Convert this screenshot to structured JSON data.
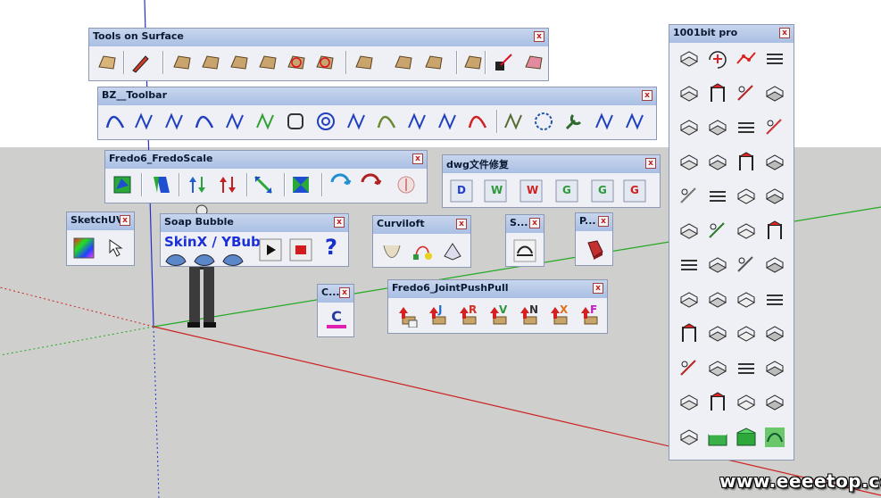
{
  "toolbars": {
    "tools_on_surface": {
      "title": "Tools on Surface"
    },
    "bz_toolbar": {
      "title": "BZ__Toolbar"
    },
    "fredo_scale": {
      "title": "Fredo6_FredoScale"
    },
    "dwg_repair": {
      "title": "dwg文件修复"
    },
    "sketchuv": {
      "title": "SketchUV"
    },
    "soap_bubble": {
      "title": "Soap Bubble",
      "label": "SkinX / YBub"
    },
    "curviloft": {
      "title": "Curviloft"
    },
    "s_small": {
      "title": "S..."
    },
    "p_small": {
      "title": "P..."
    },
    "c_small": {
      "title": "C..."
    },
    "joint_push_pull": {
      "title": "Fredo6_JointPushPull"
    },
    "bit1001": {
      "title": "1001bit pro"
    }
  },
  "dwg_buttons": [
    "D",
    "W",
    "W",
    "G",
    "G",
    "G"
  ],
  "jpp_letters": [
    "J",
    "R",
    "V",
    "N",
    "X",
    "F"
  ],
  "close_glyph": "x",
  "watermark": "www.eeeetop.com",
  "colors": {
    "sky": "#ffffff",
    "ground": "#cfcfcd",
    "titlebar": "#b9cae9",
    "axis_red": "#cc2222",
    "axis_green": "#22aa22",
    "axis_blue": "#2233cc"
  }
}
